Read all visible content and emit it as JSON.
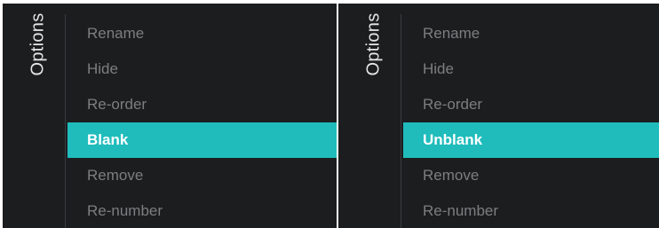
{
  "colors": {
    "panel_background": "#1c1d1f",
    "selected_background": "#20bcbc",
    "item_text": "#7d7e80",
    "selected_text": "#ffffff"
  },
  "screens": [
    {
      "title": "Options",
      "items": [
        "Rename",
        "Hide",
        "Re-order",
        "Blank",
        "Remove",
        "Re-number"
      ],
      "selected_item": "Blank"
    },
    {
      "title": "Options",
      "items": [
        "Rename",
        "Hide",
        "Re-order",
        "Unblank",
        "Remove",
        "Re-number"
      ],
      "selected_item": "Unblank"
    }
  ]
}
